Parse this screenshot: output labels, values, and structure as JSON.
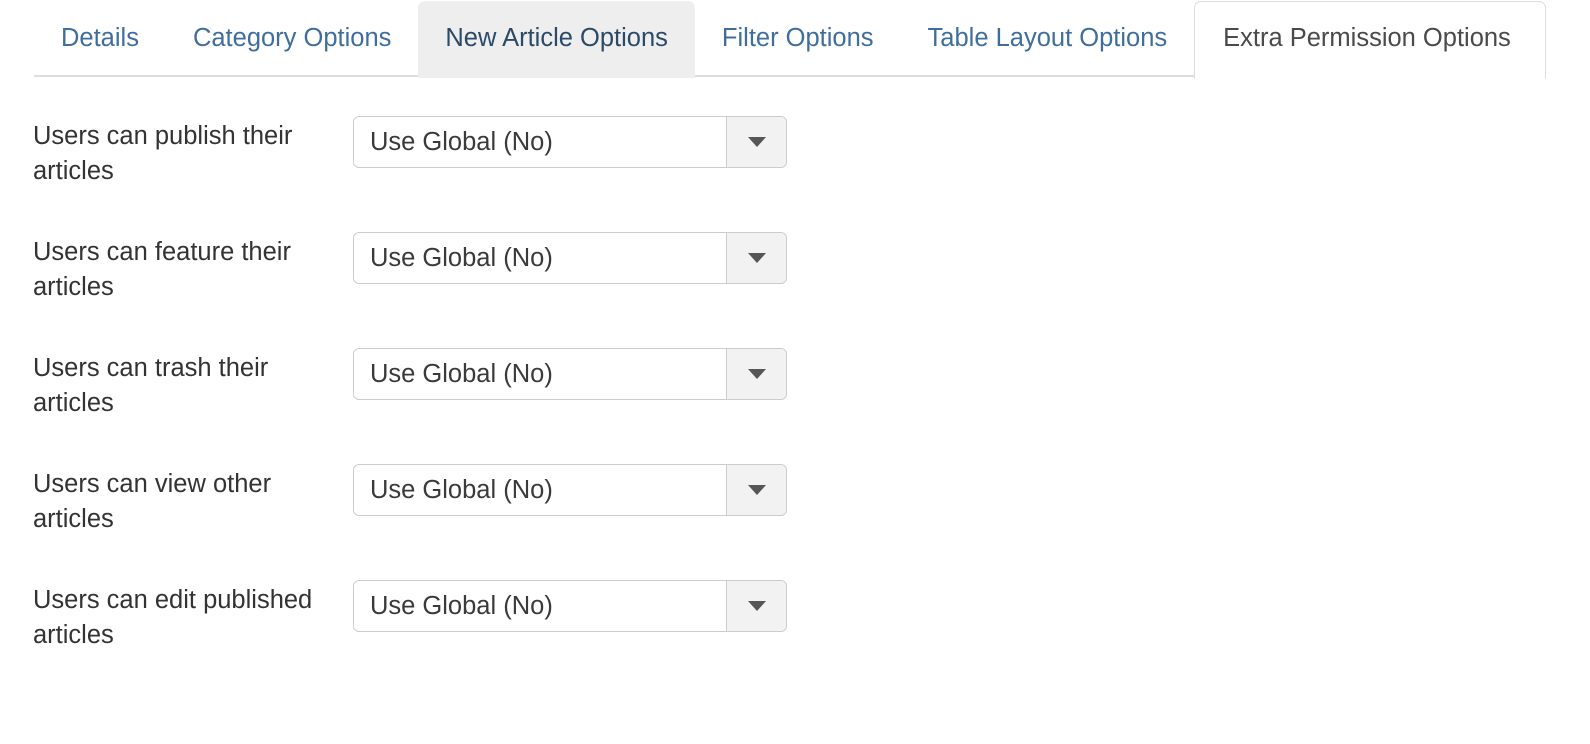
{
  "tabs": [
    {
      "label": "Details",
      "state": "normal"
    },
    {
      "label": "Category Options",
      "state": "normal"
    },
    {
      "label": "New Article Options",
      "state": "hovered"
    },
    {
      "label": "Filter Options",
      "state": "normal"
    },
    {
      "label": "Table Layout Options",
      "state": "normal"
    },
    {
      "label": "Extra Permission Options",
      "state": "active"
    }
  ],
  "fields": [
    {
      "label": "Users can publish their articles",
      "value": "Use Global (No)"
    },
    {
      "label": "Users can feature their articles",
      "value": "Use Global (No)"
    },
    {
      "label": "Users can trash their articles",
      "value": "Use Global (No)"
    },
    {
      "label": "Users can view other articles",
      "value": "Use Global (No)"
    },
    {
      "label": "Users can edit published articles",
      "value": "Use Global (No)"
    }
  ],
  "icons": {
    "dropdown_caret": "chevron-down-icon"
  },
  "colors": {
    "tab_link": "#3f6e9e",
    "tab_hover_text": "#2b4a68",
    "tab_active_text": "#4a4a4a",
    "tab_hover_bg": "#eeeeee",
    "border": "#dddddd",
    "field_border": "#cccccc",
    "field_button_bg": "#f2f2f2",
    "label_text": "#333333",
    "value_text": "#3a3a3a",
    "caret": "#565656"
  }
}
